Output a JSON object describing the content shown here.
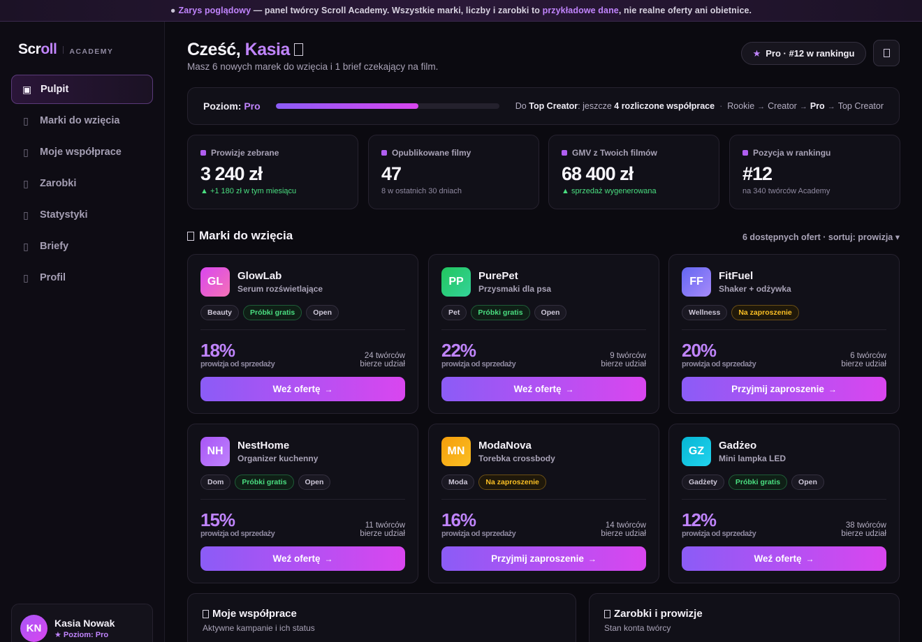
{
  "banner": {
    "dot": "●",
    "part1": "Zarys poglądowy",
    "part2": " — panel twórcy Scroll Academy. Wszystkie marki, liczby i zarobki to ",
    "part3": "przykładowe dane",
    "part4": ", nie realne oferty ani obietnice."
  },
  "logo": {
    "word_a": "Scr",
    "word_b": "oll",
    "sub": "ACADEMY"
  },
  "nav": {
    "items": [
      {
        "label": "Pulpit",
        "icon": "dashboard-icon",
        "active": true
      },
      {
        "label": "Marki do wzięcia",
        "icon": "tag-icon",
        "active": false
      },
      {
        "label": "Moje współprace",
        "icon": "handshake-icon",
        "active": false
      },
      {
        "label": "Zarobki",
        "icon": "wallet-icon",
        "active": false
      },
      {
        "label": "Statystyki",
        "icon": "chart-icon",
        "active": false
      },
      {
        "label": "Briefy",
        "icon": "document-icon",
        "active": false
      },
      {
        "label": "Profil",
        "icon": "user-icon",
        "active": false
      }
    ]
  },
  "user": {
    "initials": "KN",
    "name": "Kasia Nowak",
    "level": "★ Poziom: Pro"
  },
  "header": {
    "greet": "Cześć, ",
    "name": "Kasia",
    "subtitle": "Masz 6 nowych marek do wzięcia i 1 brief czekający na film.",
    "pill": "Pro · #12 w rankingu",
    "pill_star": "★"
  },
  "level": {
    "label": "Poziom: ",
    "value": "Pro",
    "progress": 0.64,
    "to_a": "Do ",
    "to_b": "Top Creator",
    "to_c": ": jeszcze ",
    "to_d": "4 rozliczone współprace",
    "mid": "·",
    "steps": [
      "Rookie",
      "Creator",
      "Pro",
      "Top Creator"
    ],
    "current_step": 2,
    "arrow": "→"
  },
  "stats": [
    {
      "label": "Prowizje zebrane",
      "value": "3 240 zł",
      "note": "▲ +1 180 zł w tym miesiącu",
      "up": true
    },
    {
      "label": "Opublikowane filmy",
      "value": "47",
      "note": "8 w ostatnich 30 dniach",
      "up": false
    },
    {
      "label": "GMV z Twoich filmów",
      "value": "68 400 zł",
      "note": "▲ sprzedaż wygenerowana",
      "up": true
    },
    {
      "label": "Pozycja w rankingu",
      "value": "#12",
      "note": "na 340 twórców Academy",
      "up": false
    }
  ],
  "offers_section": {
    "title": "Marki do wzięcia",
    "meta": "6 dostępnych ofert · sortuj: prowizja ▾"
  },
  "offers": [
    {
      "initials": "GL",
      "name": "GlowLab",
      "product": "Serum rozświetlające",
      "colors": [
        "#d946ef",
        "#f472b6"
      ],
      "tags": [
        {
          "t": "Beauty",
          "k": "plain"
        },
        {
          "t": "Próbki gratis",
          "k": "green"
        },
        {
          "t": "Open",
          "k": "plain"
        }
      ],
      "pct": "18%",
      "cap": "prowizja od sprzedaży",
      "count1": "24 twórców",
      "count2": "bierze udział",
      "cta": "Weź ofertę"
    },
    {
      "initials": "PP",
      "name": "PurePet",
      "product": "Przysmaki dla psa",
      "colors": [
        "#22c55e",
        "#34d399"
      ],
      "tags": [
        {
          "t": "Pet",
          "k": "plain"
        },
        {
          "t": "Próbki gratis",
          "k": "green"
        },
        {
          "t": "Open",
          "k": "plain"
        }
      ],
      "pct": "22%",
      "cap": "prowizja od sprzedaży",
      "count1": "9 twórców",
      "count2": "bierze udział",
      "cta": "Weź ofertę"
    },
    {
      "initials": "FF",
      "name": "FitFuel",
      "product": "Shaker + odżywka",
      "colors": [
        "#6366f1",
        "#a78bfa"
      ],
      "tags": [
        {
          "t": "Wellness",
          "k": "plain"
        },
        {
          "t": "Na zaproszenie",
          "k": "gold"
        }
      ],
      "pct": "20%",
      "cap": "prowizja od sprzedaży",
      "count1": "6 twórców",
      "count2": "bierze udział",
      "cta": "Przyjmij zaproszenie"
    },
    {
      "initials": "NH",
      "name": "NestHome",
      "product": "Organizer kuchenny",
      "colors": [
        "#a855f7",
        "#c084fc"
      ],
      "tags": [
        {
          "t": "Dom",
          "k": "plain"
        },
        {
          "t": "Próbki gratis",
          "k": "green"
        },
        {
          "t": "Open",
          "k": "plain"
        }
      ],
      "pct": "15%",
      "cap": "prowizja od sprzedaży",
      "count1": "11 twórców",
      "count2": "bierze udział",
      "cta": "Weź ofertę"
    },
    {
      "initials": "MN",
      "name": "ModaNova",
      "product": "Torebka crossbody",
      "colors": [
        "#f59e0b",
        "#fbbf24"
      ],
      "tags": [
        {
          "t": "Moda",
          "k": "plain"
        },
        {
          "t": "Na zaproszenie",
          "k": "gold"
        }
      ],
      "pct": "16%",
      "cap": "prowizja od sprzedaży",
      "count1": "14 twórców",
      "count2": "bierze udział",
      "cta": "Przyjmij zaproszenie"
    },
    {
      "initials": "GZ",
      "name": "Gadżeo",
      "product": "Mini lampka LED",
      "colors": [
        "#06b6d4",
        "#22d3ee"
      ],
      "tags": [
        {
          "t": "Gadżety",
          "k": "plain"
        },
        {
          "t": "Próbki gratis",
          "k": "green"
        },
        {
          "t": "Open",
          "k": "plain"
        }
      ],
      "pct": "12%",
      "cap": "prowizja od sprzedaży",
      "count1": "38 twórców",
      "count2": "bierze udział",
      "cta": "Weź ofertę"
    }
  ],
  "cta_arrow": "→",
  "bottom": {
    "collab_title": "Moje współprace",
    "collab_sub": "Aktywne kampanie i ich status",
    "earn_title": "Zarobki i prowizje",
    "earn_sub": "Stan konta twórcy"
  }
}
